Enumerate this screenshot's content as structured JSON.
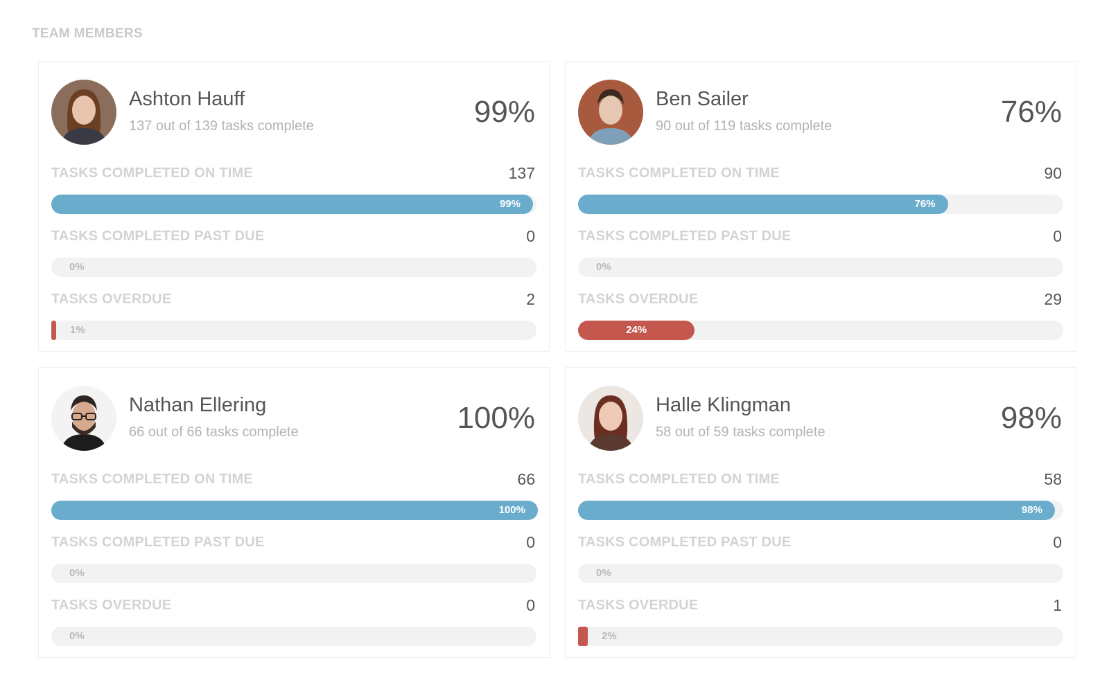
{
  "section": {
    "title": "TEAM MEMBERS"
  },
  "labels": {
    "on_time": "TASKS COMPLETED ON TIME",
    "past_due": "TASKS COMPLETED PAST DUE",
    "overdue": "TASKS OVERDUE"
  },
  "members": [
    {
      "name": "Ashton Hauff",
      "subtitle": "137 out of 139 tasks complete",
      "percent": "99%",
      "avatar": "avatar-woman-brown-hair",
      "on_time": {
        "value": "137",
        "bar_label": "99%",
        "fraction": 0.99
      },
      "past_due": {
        "value": "0",
        "bar_label": "0%",
        "fraction": 0
      },
      "overdue": {
        "value": "2",
        "bar_label": "1%",
        "fraction": 0.01
      }
    },
    {
      "name": "Ben Sailer",
      "subtitle": "90 out of 119 tasks complete",
      "percent": "76%",
      "avatar": "avatar-man-dark-hair",
      "on_time": {
        "value": "90",
        "bar_label": "76%",
        "fraction": 0.76
      },
      "past_due": {
        "value": "0",
        "bar_label": "0%",
        "fraction": 0
      },
      "overdue": {
        "value": "29",
        "bar_label": "24%",
        "fraction": 0.24
      }
    },
    {
      "name": "Nathan Ellering",
      "subtitle": "66 out of 66 tasks complete",
      "percent": "100%",
      "avatar": "avatar-man-glasses-beard",
      "on_time": {
        "value": "66",
        "bar_label": "100%",
        "fraction": 1.0
      },
      "past_due": {
        "value": "0",
        "bar_label": "0%",
        "fraction": 0
      },
      "overdue": {
        "value": "0",
        "bar_label": "0%",
        "fraction": 0
      }
    },
    {
      "name": "Halle Klingman",
      "subtitle": "58 out of 59 tasks complete",
      "percent": "98%",
      "avatar": "avatar-woman-auburn-hair",
      "on_time": {
        "value": "58",
        "bar_label": "98%",
        "fraction": 0.98
      },
      "past_due": {
        "value": "0",
        "bar_label": "0%",
        "fraction": 0
      },
      "overdue": {
        "value": "1",
        "bar_label": "2%",
        "fraction": 0.02
      }
    }
  ],
  "colors": {
    "on_time_bar": "#6aaccb",
    "overdue_bar": "#c4584f",
    "track": "#f2f2f2"
  }
}
